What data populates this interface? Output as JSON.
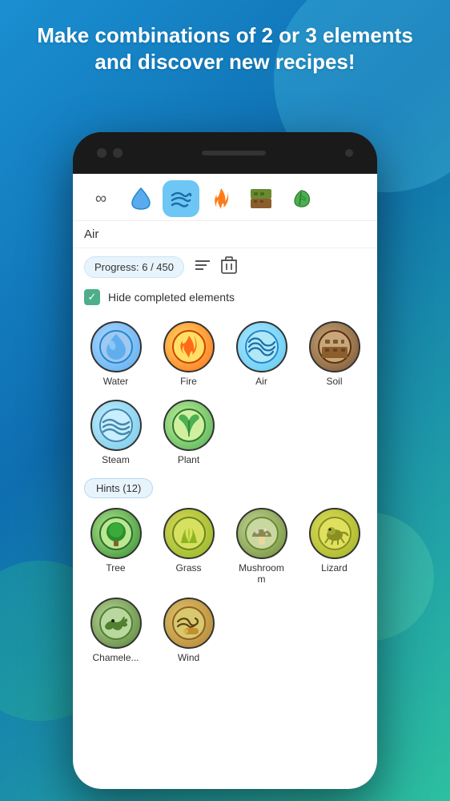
{
  "header": {
    "title": "Make combinations of 2 or 3 elements and discover new recipes!"
  },
  "tabs": [
    {
      "id": "infinity",
      "icon": "∞",
      "label": "Infinity",
      "active": false
    },
    {
      "id": "water",
      "icon": "💧",
      "label": "Water",
      "active": false
    },
    {
      "id": "air",
      "icon": "💨",
      "label": "Air",
      "active": true
    },
    {
      "id": "fire",
      "icon": "🔥",
      "label": "Fire",
      "active": false
    },
    {
      "id": "soil",
      "icon": "🪵",
      "label": "Soil",
      "active": false
    },
    {
      "id": "plant",
      "icon": "🌿",
      "label": "Plant",
      "active": false
    }
  ],
  "category_label": "Air",
  "progress": {
    "label": "Progress: 6 / 450",
    "sort_icon": "≡",
    "delete_icon": "🗑"
  },
  "checkbox": {
    "checked": true,
    "label": "Hide completed elements"
  },
  "elements": [
    {
      "id": "water",
      "label": "Water",
      "emoji": "💧",
      "css_class": "icon-water"
    },
    {
      "id": "fire",
      "label": "Fire",
      "emoji": "🔥",
      "css_class": "icon-fire"
    },
    {
      "id": "air",
      "label": "Air",
      "emoji": "🌀",
      "css_class": "icon-air"
    },
    {
      "id": "soil",
      "label": "Soil",
      "emoji": "🪨",
      "css_class": "icon-soil"
    },
    {
      "id": "steam",
      "label": "Steam",
      "emoji": "💨",
      "css_class": "icon-steam"
    },
    {
      "id": "plant",
      "label": "Plant",
      "emoji": "🌿",
      "css_class": "icon-plant"
    }
  ],
  "hints": {
    "label": "Hints (12)",
    "items": [
      {
        "id": "tree",
        "label": "Tree",
        "emoji": "🌳",
        "css_class": "icon-tree"
      },
      {
        "id": "grass",
        "label": "Grass",
        "emoji": "🌾",
        "css_class": "icon-grass"
      },
      {
        "id": "mushroom",
        "label": "Mushroom",
        "emoji": "🍄",
        "css_class": "icon-mushroom"
      },
      {
        "id": "lizard",
        "label": "Lizard",
        "emoji": "🦎",
        "css_class": "icon-lizard"
      },
      {
        "id": "chamele",
        "label": "Chamele...",
        "emoji": "🦎",
        "css_class": "icon-chamele"
      },
      {
        "id": "wind",
        "label": "Wind",
        "emoji": "💨",
        "css_class": "icon-wind"
      }
    ]
  }
}
